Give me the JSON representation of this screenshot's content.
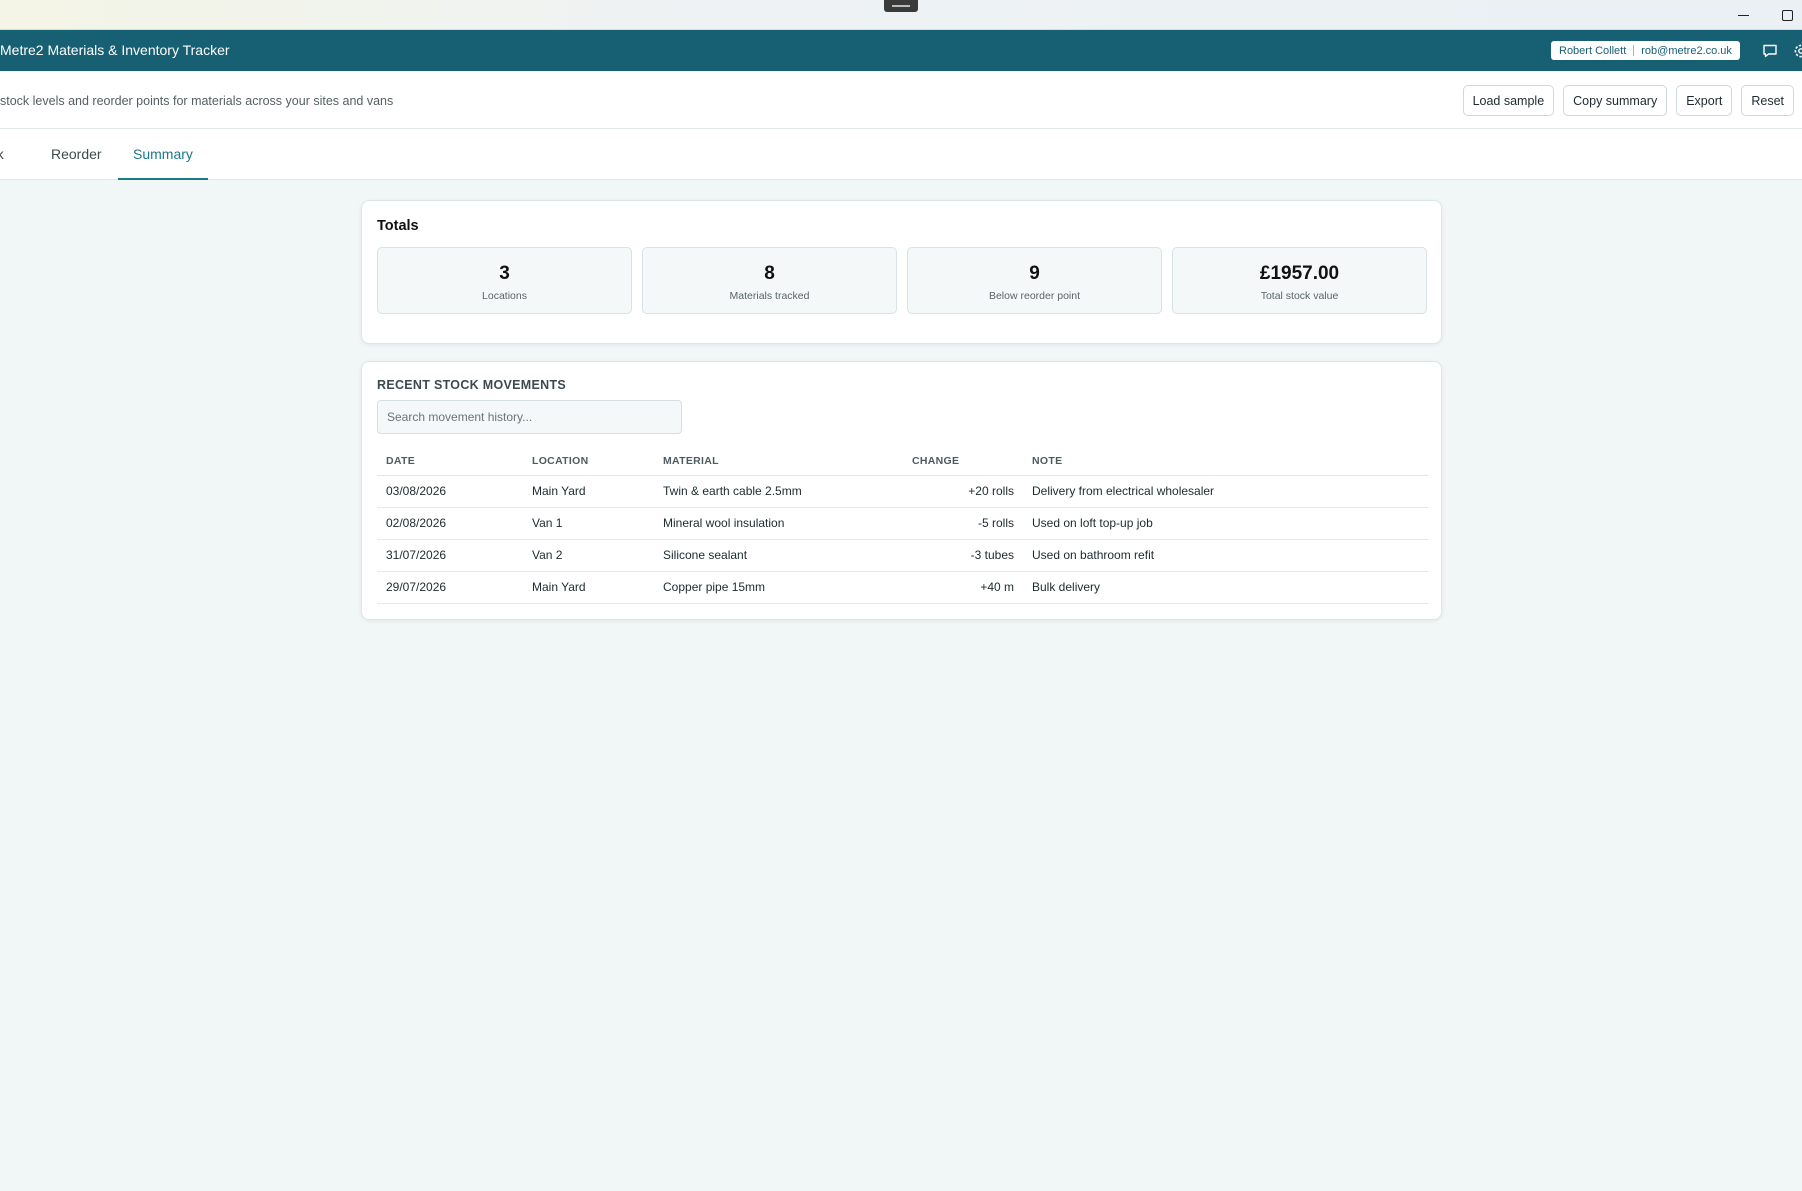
{
  "app": {
    "title": "Metre2 Materials & Inventory Tracker",
    "user_name": "Robert Collett",
    "user_email": "rob@metre2.co.uk"
  },
  "subheader": {
    "subtitle": "stock levels and reorder points for materials across your sites and vans",
    "actions": [
      "Load sample",
      "Copy summary",
      "Export",
      "Reset"
    ]
  },
  "tabs": [
    "ock",
    "Reorder",
    "Summary"
  ],
  "totals": {
    "title": "Totals",
    "stats": [
      {
        "value": "3",
        "label": "Locations"
      },
      {
        "value": "8",
        "label": "Materials tracked"
      },
      {
        "value": "9",
        "label": "Below reorder point"
      },
      {
        "value": "£1957.00",
        "label": "Total stock value"
      }
    ]
  },
  "movements": {
    "title": "RECENT STOCK MOVEMENTS",
    "search_placeholder": "Search movement history...",
    "columns": [
      "DATE",
      "LOCATION",
      "MATERIAL",
      "CHANGE",
      "NOTE"
    ],
    "rows": [
      {
        "date": "03/08/2026",
        "location": "Main Yard",
        "material": "Twin & earth cable 2.5mm",
        "change": "+20 rolls",
        "note": "Delivery from electrical wholesaler"
      },
      {
        "date": "02/08/2026",
        "location": "Van 1",
        "material": "Mineral wool insulation",
        "change": "-5 rolls",
        "note": "Used on loft top-up job"
      },
      {
        "date": "31/07/2026",
        "location": "Van 2",
        "material": "Silicone sealant",
        "change": "-3 tubes",
        "note": "Used on bathroom refit"
      },
      {
        "date": "29/07/2026",
        "location": "Main Yard",
        "material": "Copper pipe 15mm",
        "change": "+40 m",
        "note": "Bulk delivery"
      }
    ]
  },
  "icons": {
    "window_minimize": "minimize-icon",
    "window_maximize": "maximize-icon",
    "chat": "chat-icon",
    "settings": "gear-icon"
  },
  "colors": {
    "brand": "#175f73",
    "accent": "#1a7a88",
    "background": "#f1f6f6"
  }
}
